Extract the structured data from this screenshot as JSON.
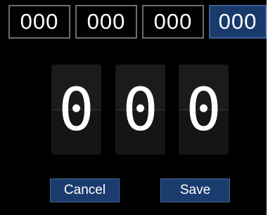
{
  "tabs": [
    {
      "label": "000",
      "selected": false
    },
    {
      "label": "000",
      "selected": false
    },
    {
      "label": "000",
      "selected": false
    },
    {
      "label": "000",
      "selected": true
    }
  ],
  "digits": [
    "0",
    "0",
    "0"
  ],
  "buttons": {
    "cancel_label": "Cancel",
    "save_label": "Save"
  },
  "colors": {
    "background": "#000000",
    "selected_tab": "#193b6c",
    "button": "#1a3c6e",
    "text": "#ffffff"
  }
}
